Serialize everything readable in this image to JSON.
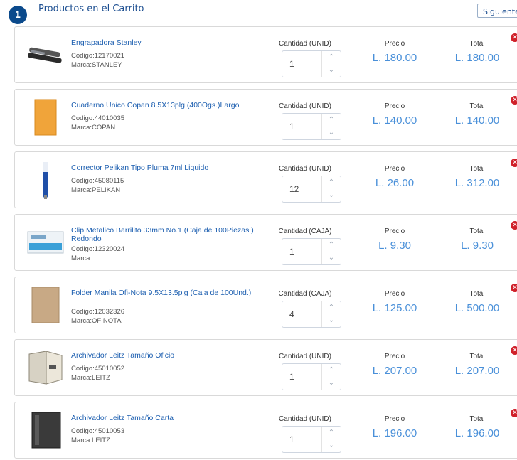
{
  "header": {
    "step_number": "1",
    "title": "Productos en el Carrito",
    "next_button": "Siguiente"
  },
  "labels": {
    "price": "Precio",
    "total": "Total"
  },
  "items": [
    {
      "name": "Engrapadora Stanley",
      "code": "Codigo:12170021",
      "brand": "Marca:STANLEY",
      "qty_label": "Cantidad (UNID)",
      "qty": "1",
      "price": "L. 180.00",
      "total": "L. 180.00",
      "thumb_icon": "stapler-image"
    },
    {
      "name": "Cuaderno Unico Copan 8.5X13plg (400Ogs.)Largo",
      "code": "Codigo:44010035",
      "brand": "Marca:COPAN",
      "qty_label": "Cantidad (UNID)",
      "qty": "1",
      "price": "L. 140.00",
      "total": "L. 140.00",
      "thumb_icon": "notebook-image"
    },
    {
      "name": "Corrector Pelikan Tipo Pluma 7ml Liquido",
      "code": "Codigo:45080115",
      "brand": "Marca:PELIKAN",
      "qty_label": "Cantidad (UNID)",
      "qty": "12",
      "price": "L. 26.00",
      "total": "L. 312.00",
      "thumb_icon": "correction-pen-image"
    },
    {
      "name": "Clip Metalico Barrilito 33mm No.1 (Caja de 100Piezas ) Redondo",
      "code": "Codigo:12320024",
      "brand": "Marca:",
      "qty_label": "Cantidad (CAJA)",
      "qty": "1",
      "price": "L. 9.30",
      "total": "L. 9.30",
      "thumb_icon": "clip-box-image"
    },
    {
      "name": "Folder Manila Ofi-Nota 9.5X13.5plg (Caja de 100Und.)",
      "code": "Codigo:12032326",
      "brand": "Marca:OFINOTA",
      "qty_label": "Cantidad (CAJA)",
      "qty": "4",
      "price": "L. 125.00",
      "total": "L. 500.00",
      "thumb_icon": "folder-image"
    },
    {
      "name": "Archivador Leitz Tamaño Oficio",
      "code": "Codigo:45010052",
      "brand": "Marca:LEITZ",
      "qty_label": "Cantidad (UNID)",
      "qty": "1",
      "price": "L. 207.00",
      "total": "L. 207.00",
      "thumb_icon": "binder-open-image"
    },
    {
      "name": "Archivador Leitz Tamaño Carta",
      "code": "Codigo:45010053",
      "brand": "Marca:LEITZ",
      "qty_label": "Cantidad (UNID)",
      "qty": "1",
      "price": "L. 196.00",
      "total": "L. 196.00",
      "thumb_icon": "binder-black-image"
    }
  ],
  "colors": {
    "accent": "#1d5fb0",
    "price": "#4a90d9",
    "badge": "#0b4a8c",
    "remove": "#d0202a"
  }
}
